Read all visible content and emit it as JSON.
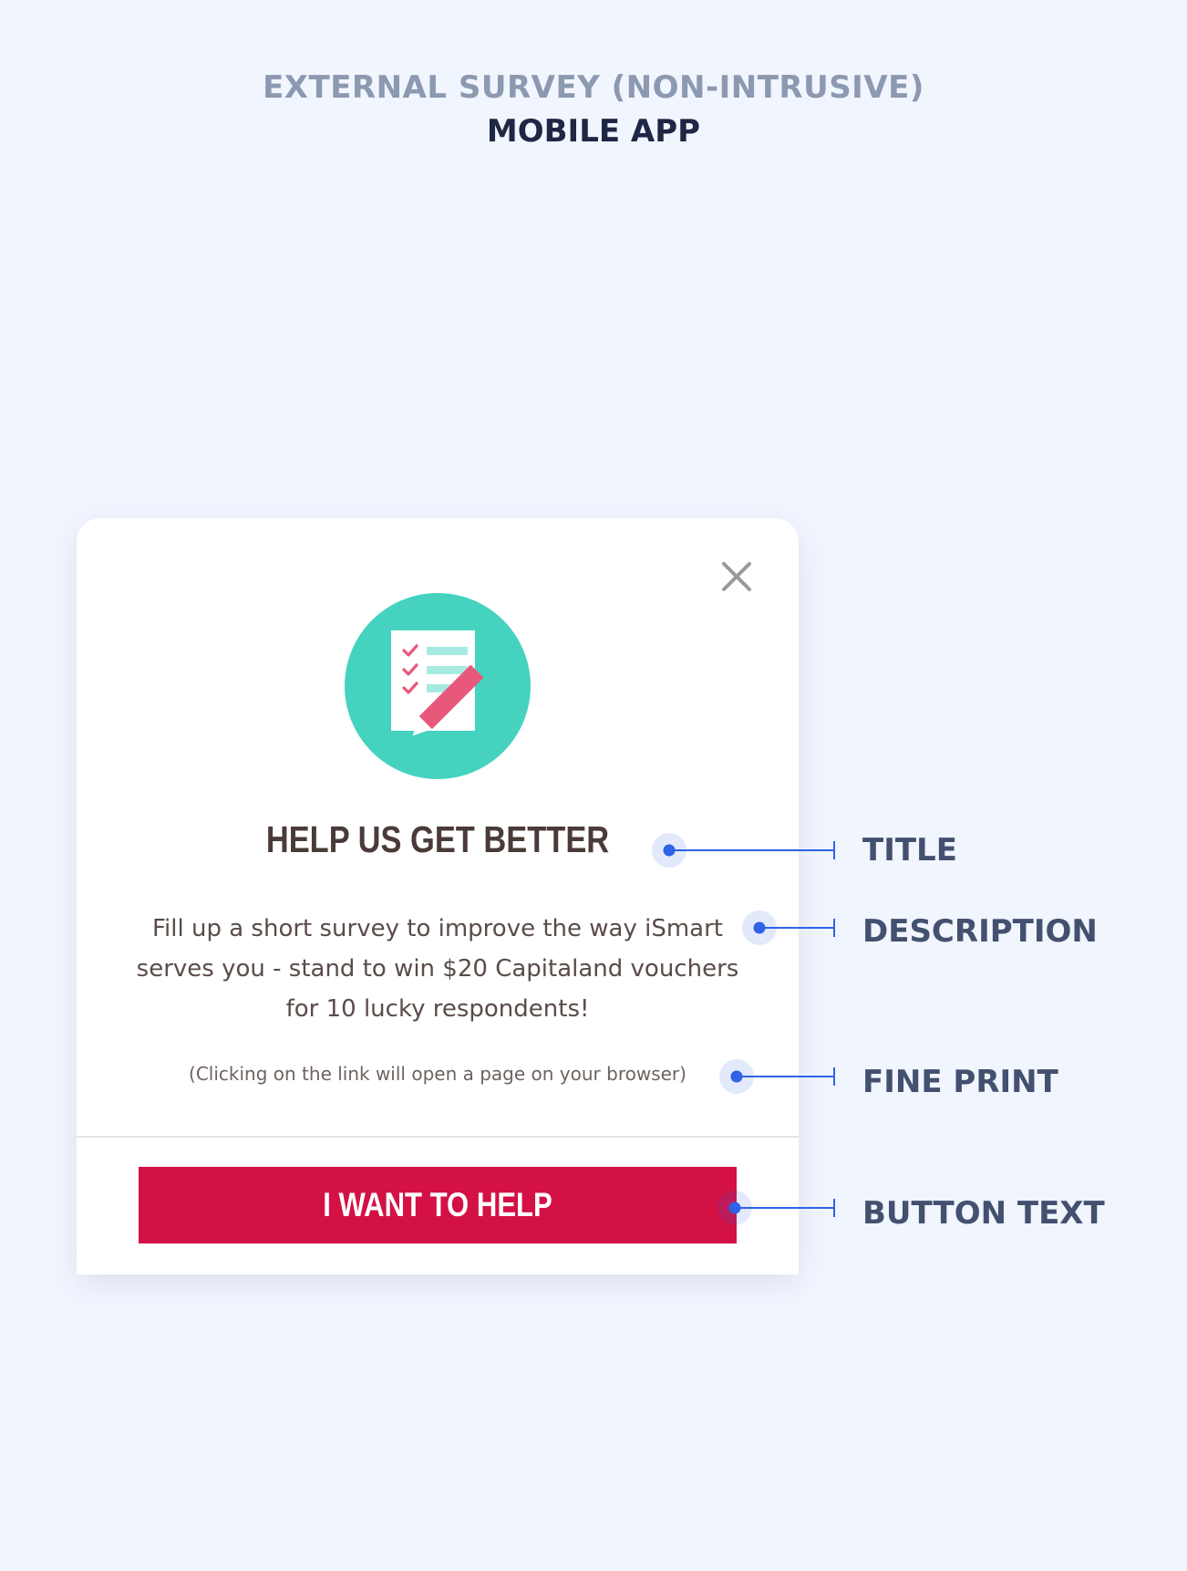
{
  "header": {
    "subtitle": "EXTERNAL SURVEY (NON-INTRUSIVE)",
    "title": "MOBILE APP"
  },
  "dialog": {
    "title": "HELP US GET BETTER",
    "description": "Fill up a short survey to improve the way iSmart serves you - stand to win $20 Capitaland vouchers for 10 lucky respondents!",
    "fine_print": "(Clicking on the link will open a page on your browser)",
    "button_label": "I WANT TO HELP",
    "close_icon": "close-icon",
    "illustration_icon": "survey-checklist-pencil-icon"
  },
  "annotations": {
    "title": "TITLE",
    "description": "DESCRIPTION",
    "fine_print": "FINE PRINT",
    "button_text": "BUTTON TEXT"
  },
  "colors": {
    "background": "#f1f5fe",
    "card": "#ffffff",
    "primary_button": "#d31145",
    "illustration_circle": "#45d3c0",
    "checkmarks": "#e8587a",
    "pencil": "#e8587a",
    "annotation_line": "#2f62e6",
    "annotation_label": "#43506f"
  }
}
